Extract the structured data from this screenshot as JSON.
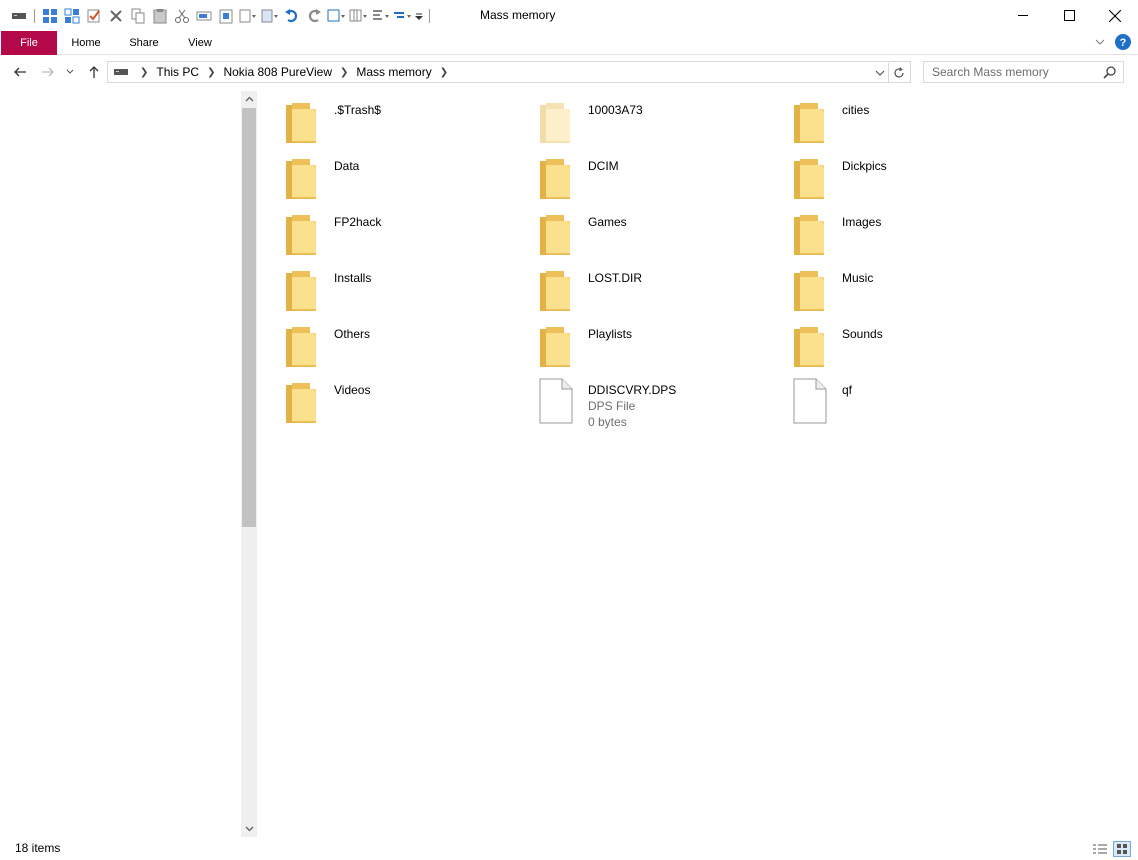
{
  "window": {
    "title": "Mass memory",
    "minimize_glyph": "—",
    "maximize_glyph": "☐",
    "close_glyph": "✕"
  },
  "ribbon": {
    "tabs": [
      {
        "label": "File"
      },
      {
        "label": "Home"
      },
      {
        "label": "Share"
      },
      {
        "label": "View"
      }
    ],
    "expand_icon": "chevron-down-icon",
    "help_icon": "help-icon"
  },
  "address": {
    "crumbs": [
      "This PC",
      "Nokia 808 PureView",
      "Mass memory"
    ]
  },
  "search": {
    "placeholder": "Search Mass memory"
  },
  "items": [
    {
      "name": ".$Trash$",
      "type": "folder"
    },
    {
      "name": "10003A73",
      "type": "folder-hidden"
    },
    {
      "name": "cities",
      "type": "folder"
    },
    {
      "name": "Data",
      "type": "folder"
    },
    {
      "name": "DCIM",
      "type": "folder"
    },
    {
      "name": "Dickpics",
      "type": "folder"
    },
    {
      "name": "FP2hack",
      "type": "folder"
    },
    {
      "name": "Games",
      "type": "folder"
    },
    {
      "name": "Images",
      "type": "folder"
    },
    {
      "name": "Installs",
      "type": "folder"
    },
    {
      "name": "LOST.DIR",
      "type": "folder"
    },
    {
      "name": "Music",
      "type": "folder"
    },
    {
      "name": "Others",
      "type": "folder"
    },
    {
      "name": "Playlists",
      "type": "folder"
    },
    {
      "name": "Sounds",
      "type": "folder"
    },
    {
      "name": "Videos",
      "type": "folder"
    },
    {
      "name": "DDISCVRY.DPS",
      "type": "file",
      "kind": "DPS File",
      "size": "0 bytes"
    },
    {
      "name": "qf",
      "type": "file"
    }
  ],
  "status": {
    "item_count": "18 items"
  },
  "colors": {
    "file_tab": "#b3084a",
    "folder": "#f8d775",
    "folder_dark": "#e6b84a",
    "accent_blue": "#1e6fc7"
  }
}
